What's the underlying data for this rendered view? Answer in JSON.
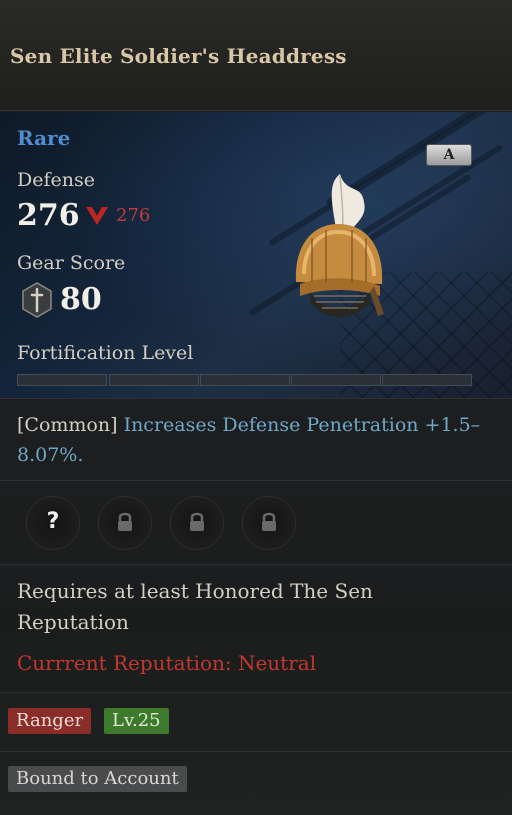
{
  "item": {
    "name": "Sen Elite Soldier's Headdress",
    "rarity": "Rare",
    "grade_badge": "A"
  },
  "stats": {
    "defense_label": "Defense",
    "defense_value": "276",
    "defense_compare": "276",
    "gear_score_label": "Gear Score",
    "gear_score_value": "80",
    "fortification_label": "Fortification Level",
    "fortification_segments_filled": 0,
    "fortification_segments_total": 5
  },
  "effect": {
    "prefix": "[Common]",
    "text": "Increases Defense Penetration +1.5–8.07%."
  },
  "sockets": [
    {
      "icon": "question-icon"
    },
    {
      "icon": "lock-icon"
    },
    {
      "icon": "lock-icon"
    },
    {
      "icon": "lock-icon"
    }
  ],
  "requirement": {
    "text": "Requires at least Honored The Sen Reputation",
    "current": "Currrent Reputation: Neutral"
  },
  "tags": {
    "class": "Ranger",
    "level": "Lv.25",
    "binding": "Bound to Account"
  },
  "colors": {
    "rarity": "#4d8fd1",
    "warning": "#c2382e",
    "class_tag": "#8a2d28",
    "level_tag": "#3e7a2c"
  }
}
